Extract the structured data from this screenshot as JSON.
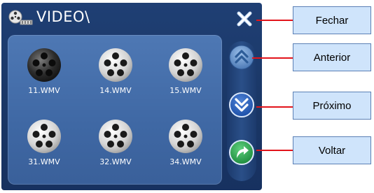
{
  "window": {
    "title": "VIDEO\\",
    "title_icon": "film-reel-camera-icon",
    "close_icon": "close-x-icon"
  },
  "files": [
    {
      "name": "11.WMV",
      "icon": "film-reel-icon",
      "selected": true
    },
    {
      "name": "14.WMV",
      "icon": "film-reel-icon",
      "selected": false
    },
    {
      "name": "15.WMV",
      "icon": "film-reel-icon",
      "selected": false
    },
    {
      "name": "31.WMV",
      "icon": "film-reel-icon",
      "selected": false
    },
    {
      "name": "32.WMV",
      "icon": "film-reel-icon",
      "selected": false
    },
    {
      "name": "34.WMV",
      "icon": "film-reel-icon",
      "selected": false
    }
  ],
  "navigation": {
    "up_icon": "double-chevron-up-icon",
    "down_icon": "double-chevron-down-icon",
    "back_icon": "return-arrow-icon"
  },
  "callouts": {
    "close": "Fechar",
    "previous": "Anterior",
    "next": "Próximo",
    "back": "Voltar"
  },
  "colors": {
    "background": "#1f3f74",
    "panel": "#4e78b4",
    "callout_fill": "#cfe4fb",
    "leader_line": "#e2141b",
    "back_button": "#2fa84f"
  }
}
